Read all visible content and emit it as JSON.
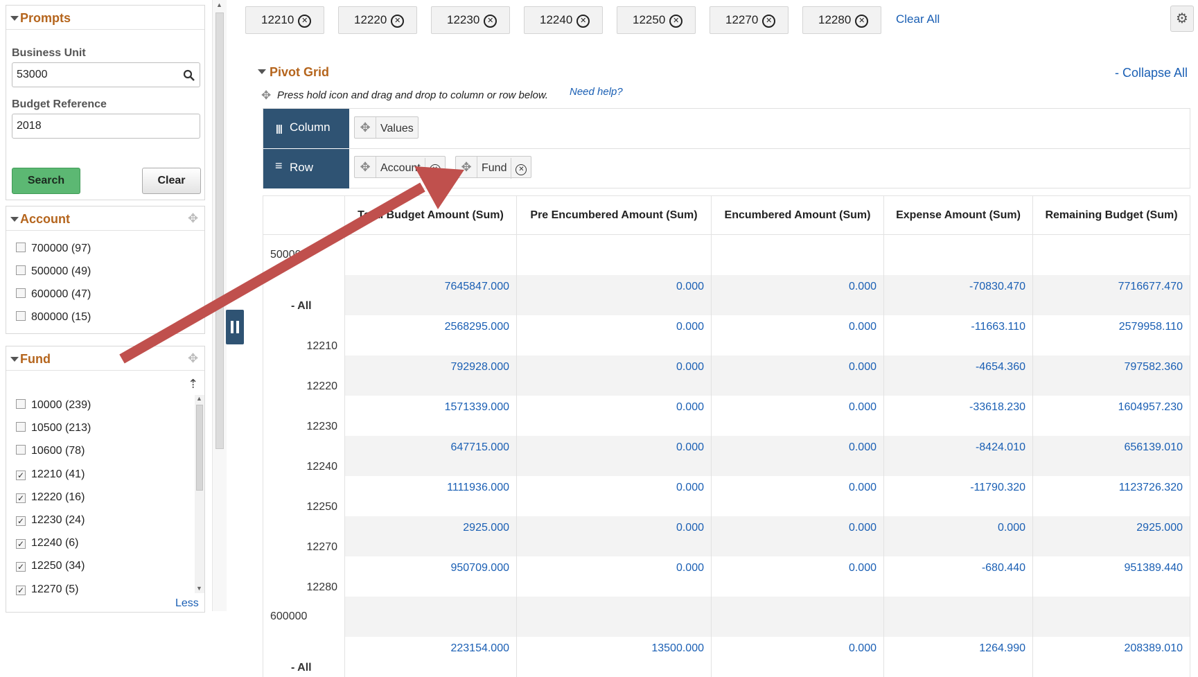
{
  "prompts": {
    "title": "Prompts",
    "business_unit_label": "Business Unit",
    "business_unit_value": "53000",
    "budget_ref_label": "Budget Reference",
    "budget_ref_value": "2018",
    "search_label": "Search",
    "clear_label": "Clear"
  },
  "account_panel": {
    "title": "Account",
    "items": [
      {
        "label": "700000 (97)",
        "checked": false
      },
      {
        "label": "500000 (49)",
        "checked": false
      },
      {
        "label": "600000 (47)",
        "checked": false
      },
      {
        "label": "800000 (15)",
        "checked": false
      }
    ]
  },
  "fund_panel": {
    "title": "Fund",
    "less_label": "Less",
    "items": [
      {
        "label": "10000 (239)",
        "checked": false
      },
      {
        "label": "10500 (213)",
        "checked": false
      },
      {
        "label": "10600 (78)",
        "checked": false
      },
      {
        "label": "12210 (41)",
        "checked": true
      },
      {
        "label": "12220 (16)",
        "checked": true
      },
      {
        "label": "12230 (24)",
        "checked": true
      },
      {
        "label": "12240 (6)",
        "checked": true
      },
      {
        "label": "12250 (34)",
        "checked": true
      },
      {
        "label": "12270 (5)",
        "checked": true
      }
    ]
  },
  "filters": {
    "chips": [
      "12210",
      "12220",
      "12230",
      "12240",
      "12250",
      "12270",
      "12280"
    ],
    "clear_all_label": "Clear All"
  },
  "pivot": {
    "title": "Pivot Grid",
    "collapse_all_label": "- Collapse All",
    "hint": "Press hold icon and drag and drop to column or row below.",
    "help_label": "Need help?",
    "column_label": "Column",
    "row_label": "Row",
    "column_fields": [
      "Values"
    ],
    "row_fields": [
      "Account",
      "Fund"
    ]
  },
  "grid": {
    "headers": [
      "Total Budget Amount (Sum)",
      "Pre Encumbered Amount (Sum)",
      "Encumbered Amount (Sum)",
      "Expense Amount (Sum)",
      "Remaining Budget (Sum)"
    ],
    "rows": [
      {
        "label": "500000",
        "indent": 0,
        "bold": false,
        "values": [
          "",
          "",
          "",
          "",
          ""
        ]
      },
      {
        "label": "- All",
        "indent": 1,
        "bold": true,
        "values": [
          "7645847.000",
          "0.000",
          "0.000",
          "-70830.470",
          "7716677.470"
        ]
      },
      {
        "label": "12210",
        "indent": 2,
        "bold": false,
        "values": [
          "2568295.000",
          "0.000",
          "0.000",
          "-11663.110",
          "2579958.110"
        ]
      },
      {
        "label": "12220",
        "indent": 2,
        "bold": false,
        "values": [
          "792928.000",
          "0.000",
          "0.000",
          "-4654.360",
          "797582.360"
        ]
      },
      {
        "label": "12230",
        "indent": 2,
        "bold": false,
        "values": [
          "1571339.000",
          "0.000",
          "0.000",
          "-33618.230",
          "1604957.230"
        ]
      },
      {
        "label": "12240",
        "indent": 2,
        "bold": false,
        "values": [
          "647715.000",
          "0.000",
          "0.000",
          "-8424.010",
          "656139.010"
        ]
      },
      {
        "label": "12250",
        "indent": 2,
        "bold": false,
        "values": [
          "1111936.000",
          "0.000",
          "0.000",
          "-11790.320",
          "1123726.320"
        ]
      },
      {
        "label": "12270",
        "indent": 2,
        "bold": false,
        "values": [
          "2925.000",
          "0.000",
          "0.000",
          "0.000",
          "2925.000"
        ]
      },
      {
        "label": "12280",
        "indent": 2,
        "bold": false,
        "values": [
          "950709.000",
          "0.000",
          "0.000",
          "-680.440",
          "951389.440"
        ]
      },
      {
        "label": "600000",
        "indent": 0,
        "bold": false,
        "values": [
          "",
          "",
          "",
          "",
          ""
        ]
      },
      {
        "label": "- All",
        "indent": 1,
        "bold": true,
        "values": [
          "223154.000",
          "13500.000",
          "0.000",
          "1264.990",
          "208389.010"
        ]
      }
    ]
  },
  "colors": {
    "accent_orange": "#b5651d",
    "link_blue": "#1a5fb4",
    "header_navy": "#2f5373",
    "search_green": "#5cb873",
    "annotation_arrow": "#c0504d"
  }
}
